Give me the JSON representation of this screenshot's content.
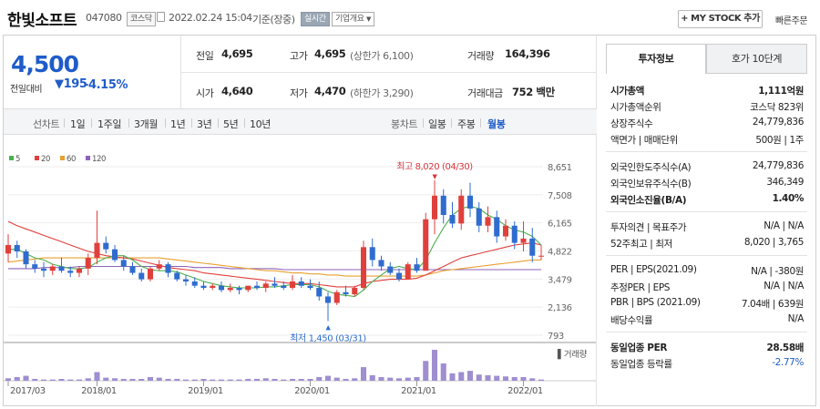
{
  "header": {
    "name": "한빛소프트",
    "code": "047080",
    "market": "코스닥",
    "timestamp": "2022.02.24 15:04",
    "basis": "기준(장중)",
    "live_tag": "실시간",
    "company_info": "기업개요",
    "mystock": "MY STOCK 추가",
    "quick_order": "빠른주문"
  },
  "quote": {
    "price": "4,500",
    "change_label": "전일대비",
    "change": "195",
    "change_pct": "-4.15%",
    "prev_close_label": "전일",
    "prev_close": "4,695",
    "open_label": "시가",
    "open": "4,640",
    "high_label": "고가",
    "high": "4,695",
    "upper_limit": "(상한가 6,100)",
    "low_label": "저가",
    "low": "4,470",
    "lower_limit": "(하한가 3,290)",
    "volume_label": "거래량",
    "volume": "164,396",
    "amount_label": "거래대금",
    "amount": "752 백만"
  },
  "chart_tabs": {
    "line_label": "선차트",
    "line_items": [
      "1일",
      "1주일",
      "3개월",
      "1년",
      "3년",
      "5년",
      "10년"
    ],
    "candle_label": "봉차트",
    "candle_items": [
      "일봉",
      "주봉",
      "월봉"
    ],
    "candle_active": "월봉"
  },
  "legend": [
    {
      "label": "5",
      "color": "#4caf50"
    },
    {
      "label": "20",
      "color": "#e0403c"
    },
    {
      "label": "60",
      "color": "#e8a030"
    },
    {
      "label": "120",
      "color": "#8e62b8"
    }
  ],
  "chart_data": {
    "type": "candlestick",
    "yticks": [
      "8,651",
      "7,508",
      "6,165",
      "4,822",
      "3,479",
      "2,136",
      "793"
    ],
    "ylim": [
      793,
      8651
    ],
    "xticks": [
      {
        "label": "2017/03",
        "x": 0
      },
      {
        "label": "2018/01",
        "x": 10
      },
      {
        "label": "2019/01",
        "x": 22
      },
      {
        "label": "2020/01",
        "x": 34
      },
      {
        "label": "2021/01",
        "x": 46
      },
      {
        "label": "2022/01",
        "x": 58
      }
    ],
    "max_note": "최고 8,020 (04/30)",
    "min_note": "최저 1,450 (03/31)",
    "volume_label": "거래량",
    "candles": [
      [
        4600,
        5500,
        4200,
        5000
      ],
      [
        5000,
        5200,
        4400,
        4700
      ],
      [
        4700,
        4800,
        3900,
        4100
      ],
      [
        4100,
        4300,
        3700,
        3900
      ],
      [
        3900,
        4200,
        3500,
        3800
      ],
      [
        3800,
        4100,
        3600,
        4000
      ],
      [
        4000,
        4400,
        3700,
        3800
      ],
      [
        3800,
        4000,
        3500,
        3700
      ],
      [
        3700,
        4000,
        3500,
        3900
      ],
      [
        3900,
        4600,
        3600,
        4400
      ],
      [
        4400,
        6600,
        4100,
        5100
      ],
      [
        5100,
        5400,
        4600,
        4800
      ],
      [
        4800,
        5000,
        4200,
        4300
      ],
      [
        4300,
        4500,
        3800,
        4000
      ],
      [
        4000,
        4200,
        3600,
        3700
      ],
      [
        3700,
        3900,
        3300,
        3400
      ],
      [
        3400,
        4000,
        3300,
        3900
      ],
      [
        3900,
        4300,
        3800,
        4100
      ],
      [
        4100,
        4200,
        3500,
        3700
      ],
      [
        3700,
        3800,
        3300,
        3400
      ],
      [
        3400,
        3600,
        3100,
        3300
      ],
      [
        3300,
        3500,
        3000,
        3100
      ],
      [
        3100,
        3300,
        2900,
        3000
      ],
      [
        3000,
        3200,
        2900,
        3100
      ],
      [
        3100,
        3300,
        2800,
        2900
      ],
      [
        2900,
        3200,
        2800,
        3000
      ],
      [
        3000,
        3100,
        2700,
        2900
      ],
      [
        2900,
        3100,
        2800,
        3100
      ],
      [
        3100,
        3300,
        2900,
        3000
      ],
      [
        3000,
        3300,
        2800,
        3200
      ],
      [
        3200,
        3500,
        3000,
        3100
      ],
      [
        3100,
        3300,
        2900,
        3000
      ],
      [
        3000,
        3600,
        2900,
        3300
      ],
      [
        3300,
        3500,
        3000,
        3100
      ],
      [
        3100,
        3400,
        2900,
        3000
      ],
      [
        3000,
        3300,
        2400,
        2600
      ],
      [
        2600,
        2800,
        1450,
        2300
      ],
      [
        2300,
        2900,
        2200,
        2800
      ],
      [
        2800,
        3100,
        2600,
        2700
      ],
      [
        2700,
        3100,
        2600,
        3000
      ],
      [
        3000,
        5200,
        2900,
        4900
      ],
      [
        4900,
        5300,
        4000,
        4300
      ],
      [
        4300,
        4500,
        3800,
        4000
      ],
      [
        4000,
        4200,
        3600,
        3700
      ],
      [
        3700,
        3900,
        3300,
        3400
      ],
      [
        3400,
        4200,
        3400,
        4100
      ],
      [
        4100,
        4400,
        3700,
        3800
      ],
      [
        3800,
        6500,
        3800,
        6200
      ],
      [
        6200,
        8020,
        5500,
        7300
      ],
      [
        7300,
        7600,
        6000,
        6400
      ],
      [
        6400,
        7000,
        5800,
        6000
      ],
      [
        6000,
        7600,
        5700,
        7300
      ],
      [
        7300,
        7900,
        6300,
        6700
      ],
      [
        6700,
        7000,
        5600,
        5900
      ],
      [
        5900,
        6800,
        5600,
        6300
      ],
      [
        6300,
        6600,
        5100,
        5400
      ],
      [
        5400,
        6200,
        5200,
        5900
      ],
      [
        5900,
        6100,
        4800,
        5100
      ],
      [
        5100,
        6100,
        4700,
        5300
      ],
      [
        5300,
        5800,
        4200,
        4500
      ],
      [
        4500,
        5000,
        4300,
        4500
      ]
    ],
    "volume": [
      4,
      6,
      8,
      3,
      2,
      2,
      3,
      2,
      2,
      4,
      14,
      5,
      4,
      3,
      3,
      3,
      6,
      5,
      3,
      3,
      2,
      2,
      3,
      2,
      2,
      2,
      2,
      3,
      3,
      4,
      3,
      2,
      3,
      3,
      3,
      6,
      8,
      5,
      3,
      4,
      22,
      9,
      6,
      5,
      4,
      5,
      6,
      32,
      50,
      28,
      12,
      14,
      16,
      10,
      9,
      8,
      7,
      6,
      6,
      4,
      2
    ],
    "ma5": [
      4800,
      4800,
      4600,
      4400,
      4300,
      4100,
      4000,
      3900,
      3900,
      3950,
      4200,
      4400,
      4500,
      4500,
      4300,
      4000,
      3850,
      3800,
      3800,
      3750,
      3600,
      3450,
      3300,
      3200,
      3100,
      3050,
      3000,
      3000,
      3000,
      3050,
      3050,
      3100,
      3150,
      3150,
      3150,
      3050,
      2850,
      2700,
      2650,
      2600,
      2900,
      3300,
      3600,
      3900,
      4000,
      3900,
      3850,
      4300,
      5100,
      5800,
      6400,
      6700,
      6800,
      6700,
      6400,
      6200,
      5900,
      5700,
      5600,
      5400,
      5000
    ],
    "ma20": [
      6100,
      5900,
      5750,
      5600,
      5450,
      5300,
      5150,
      5000,
      4850,
      4700,
      4600,
      4500,
      4450,
      4400,
      4350,
      4250,
      4150,
      4050,
      3950,
      3900,
      3850,
      3800,
      3700,
      3650,
      3600,
      3550,
      3500,
      3450,
      3400,
      3350,
      3300,
      3250,
      3200,
      3200,
      3200,
      3150,
      3100,
      3050,
      3050,
      3050,
      3200,
      3300,
      3350,
      3400,
      3400,
      3400,
      3450,
      3600,
      3800,
      4000,
      4200,
      4400,
      4500,
      4600,
      4700,
      4800,
      4900,
      5000,
      5050,
      5100,
      5000
    ],
    "ma60": [
      4200,
      4250,
      4300,
      4350,
      4400,
      4400,
      4400,
      4400,
      4400,
      4400,
      4400,
      4400,
      4400,
      4400,
      4400,
      4400,
      4400,
      4400,
      4350,
      4300,
      4250,
      4200,
      4150,
      4100,
      4050,
      4000,
      3950,
      3900,
      3850,
      3800,
      3800,
      3750,
      3700,
      3700,
      3650,
      3650,
      3600,
      3600,
      3550,
      3550,
      3550,
      3550,
      3550,
      3550,
      3550,
      3550,
      3550,
      3600,
      3700,
      3800,
      3850,
      3900,
      3950,
      4000,
      4050,
      4100,
      4150,
      4200,
      4250,
      4300,
      4300
    ],
    "ma120": [
      3900,
      3900,
      3900,
      3900,
      3950,
      3950,
      3950,
      3950,
      4000,
      4000,
      4000,
      4000,
      4000,
      4000,
      4000,
      4000,
      4000,
      4000,
      4000,
      4000,
      4000,
      3950,
      3950,
      3950,
      3950,
      3900,
      3900,
      3900,
      3900,
      3900,
      3900,
      3850,
      3850,
      3850,
      3850,
      3850,
      3850,
      3850,
      3850,
      3850,
      3850,
      3850,
      3850,
      3850,
      3850,
      3850,
      3850,
      3850,
      3850,
      3850,
      3850,
      3850,
      3850,
      3850,
      3850,
      3850,
      3850,
      3850,
      3850,
      3850,
      3850
    ]
  },
  "side": {
    "tab_active": "투자정보",
    "tab_other": "호가 10단계",
    "rows": [
      {
        "l": "시가총액",
        "v": "1,111억원",
        "bold": true
      },
      {
        "l": "시가총액순위",
        "v": "코스닥 823위"
      },
      {
        "l": "상장주식수",
        "v": "24,779,836"
      },
      {
        "l": "액면가 | 매매단위",
        "v": "500원 | 1주"
      },
      {
        "l": "외국인한도주식수(A)",
        "v": "24,779,836"
      },
      {
        "l": "외국인보유주식수(B)",
        "v": "346,349"
      },
      {
        "l": "외국인소진율(B/A)",
        "v": "1.40%",
        "bold": true
      },
      {
        "l": "투자의견 | 목표주가",
        "v": "N/A | N/A"
      },
      {
        "l": "52주최고 | 최저",
        "v": "8,020 | 3,765"
      },
      {
        "l": "PER | EPS(2021.09)",
        "v": "N/A | -380원"
      },
      {
        "l": "추정PER | EPS",
        "v": "N/A | N/A"
      },
      {
        "l": "PBR | BPS (2021.09)",
        "v": "7.04배 | 639원"
      },
      {
        "l": "배당수익률",
        "v": "N/A"
      },
      {
        "l": "동일업종 PER",
        "v": "28.58배",
        "bold": true
      },
      {
        "l": "동일업종 등락률",
        "v": "-2.77%",
        "blue": true
      }
    ]
  }
}
